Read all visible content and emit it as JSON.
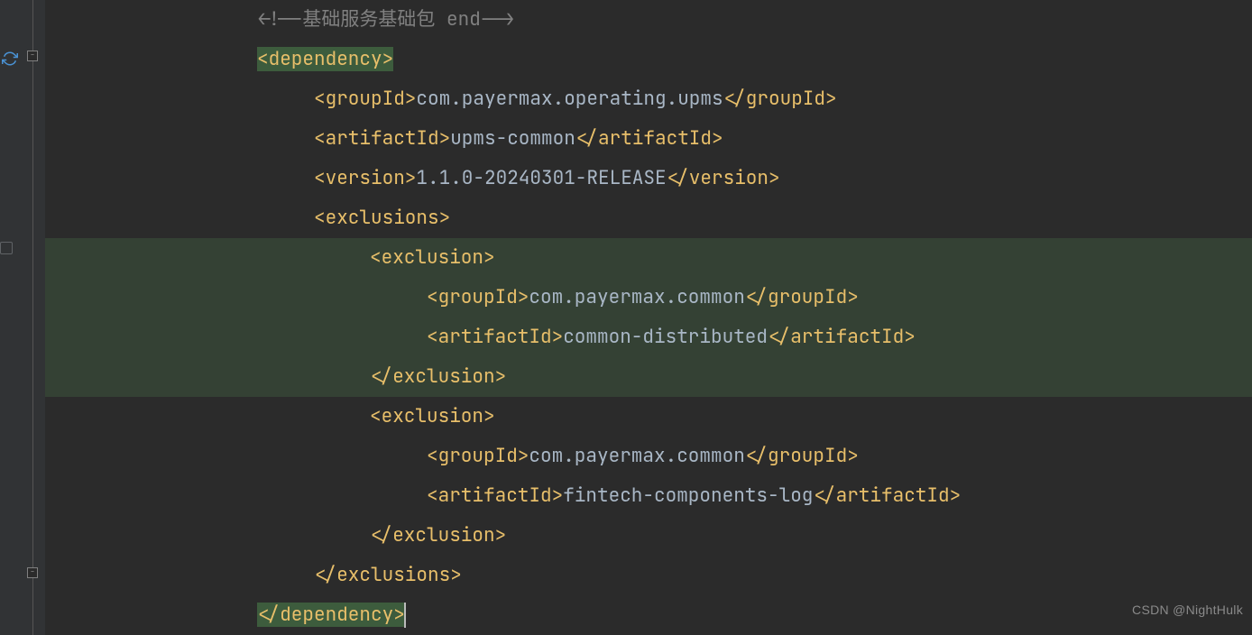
{
  "watermark": "CSDN @NightHulk",
  "code": {
    "comment_line": "<!--基础服务基础包 end-->",
    "dependency_open": "<dependency>",
    "dependency_close": "</dependency>",
    "groupId_open": "<groupId>",
    "groupId_close": "</groupId>",
    "artifactId_open": "<artifactId>",
    "artifactId_close": "</artifactId>",
    "version_open": "<version>",
    "version_close": "</version>",
    "exclusions_open": "<exclusions>",
    "exclusions_close": "</exclusions>",
    "exclusion_open": "<exclusion>",
    "exclusion_close": "</exclusion>",
    "dep_groupId_val": "com.payermax.operating.upms",
    "dep_artifactId_val": "upms-common",
    "dep_version_val": "1.1.0-20240301-RELEASE",
    "excl1_groupId_val": "com.payermax.common",
    "excl1_artifactId_val": "common-distributed",
    "excl2_groupId_val": "com.payermax.common",
    "excl2_artifactId_val": "fintech-components-log"
  }
}
